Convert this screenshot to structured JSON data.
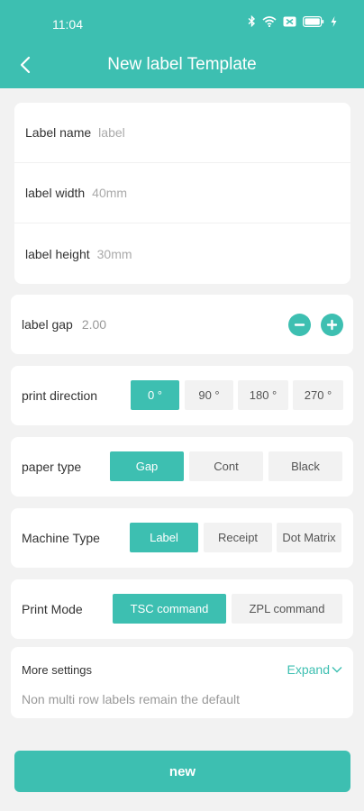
{
  "status_bar": {
    "time": "11:04"
  },
  "header": {
    "title": "New label Template"
  },
  "label_info": {
    "name_label": "Label name",
    "name_value": "label",
    "width_label": "label width",
    "width_value": "40mm",
    "height_label": "label height",
    "height_value": "30mm"
  },
  "label_gap": {
    "label": "label gap",
    "value": "2.00"
  },
  "print_direction": {
    "label": "print direction",
    "options": [
      "0 °",
      "90 °",
      "180 °",
      "270 °"
    ],
    "selected": "0 °"
  },
  "paper_type": {
    "label": "paper type",
    "options": [
      "Gap",
      "Cont",
      "Black"
    ],
    "selected": "Gap"
  },
  "machine_type": {
    "label": "Machine Type",
    "options": [
      "Label",
      "Receipt",
      "Dot Matrix"
    ],
    "selected": "Label"
  },
  "print_mode": {
    "label": "Print Mode",
    "options": [
      "TSC command",
      "ZPL command"
    ],
    "selected": "TSC command"
  },
  "more_settings": {
    "title": "More settings",
    "expand_label": "Expand",
    "description": "Non multi row labels remain the default"
  },
  "actions": {
    "new_label": "new"
  },
  "colors": {
    "accent": "#3dbfb1",
    "background": "#f2f2f2"
  }
}
